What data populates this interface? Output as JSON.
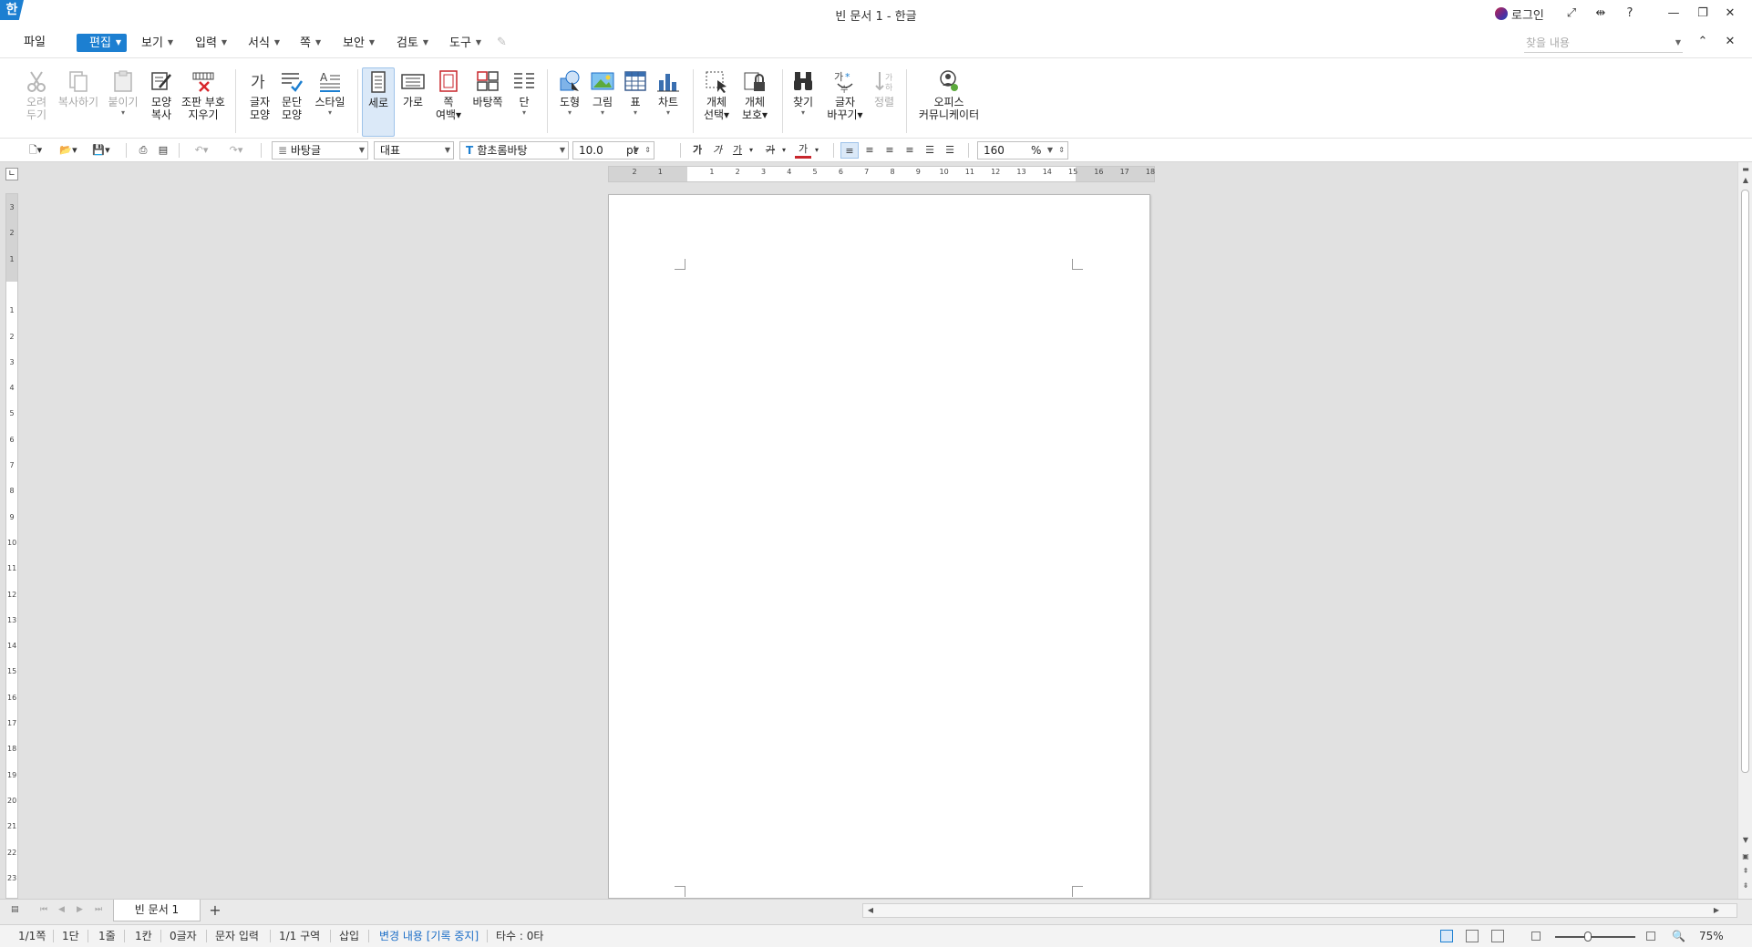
{
  "window": {
    "title": "빈 문서 1 - 한글",
    "logo_text": "한",
    "login_label": "로그인"
  },
  "menu": {
    "file": "파일",
    "edit": "편집",
    "view": "보기",
    "input": "입력",
    "format": "서식",
    "page": "쪽",
    "security": "보안",
    "review": "검토",
    "tools": "도구",
    "find_placeholder": "찾을 내용"
  },
  "ribbon": {
    "cut": [
      "오려",
      "두기"
    ],
    "copy": "복사하기",
    "paste": "붙이기",
    "format_copy": [
      "모양",
      "복사"
    ],
    "clear_typo": [
      "조판 부호",
      "지우기"
    ],
    "char_shape": [
      "글자",
      "모양"
    ],
    "para_shape": [
      "문단",
      "모양"
    ],
    "style": "스타일",
    "portrait": "세로",
    "landscape": "가로",
    "page_margin": [
      "쪽",
      "여백"
    ],
    "master_page": "바탕쪽",
    "column": "단",
    "shape": "도형",
    "picture": "그림",
    "table": "표",
    "chart": "차트",
    "object_select": [
      "개체",
      "선택"
    ],
    "object_protect": [
      "개체",
      "보호"
    ],
    "find": "찾기",
    "replace": [
      "글자",
      "바꾸기"
    ],
    "sort": "정렬",
    "office_communicator": [
      "오피스",
      "커뮤니케이터"
    ]
  },
  "toolbar": {
    "style_value": "바탕글",
    "font_group": "대표",
    "font_name": "함초롬바탕",
    "font_size": "10.0",
    "font_unit": "pt",
    "bold": "가",
    "italic": "가",
    "underline": "가",
    "strike": "가",
    "font_color": "가",
    "zoom_value": "160",
    "zoom_unit": "%"
  },
  "ruler": {
    "h_ticks": [
      "2",
      "1",
      "",
      "1",
      "2",
      "3",
      "4",
      "5",
      "6",
      "7",
      "8",
      "9",
      "10",
      "11",
      "12",
      "13",
      "14",
      "15",
      "16",
      "17",
      "18"
    ],
    "v_ticks": [
      "3",
      "2",
      "1",
      "",
      "1",
      "2",
      "3",
      "4",
      "5",
      "6",
      "7",
      "8",
      "9",
      "10",
      "11",
      "12",
      "13",
      "14",
      "15",
      "16",
      "17",
      "18",
      "19",
      "20",
      "21",
      "22",
      "23"
    ]
  },
  "tabs": {
    "doc_tab": "빈 문서 1",
    "add": "+"
  },
  "status": {
    "page": "1/1쪽",
    "column": "1단",
    "line": "1줄",
    "col": "1칸",
    "chars": "0글자",
    "input_mode": "문자 입력",
    "section": "1/1 구역",
    "insert": "삽입",
    "track_changes": "변경 내용 [기록 중지]",
    "typing_count": "타수 : 0타",
    "zoom": "75%"
  },
  "colors": {
    "accent": "#1c7fd1",
    "workspace": "#e1e1e1",
    "track_text": "#1c6ec7"
  }
}
